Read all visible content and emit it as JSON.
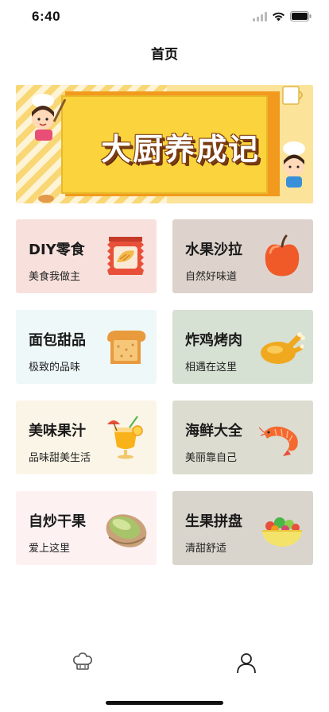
{
  "status_bar": {
    "time": "6:40"
  },
  "nav": {
    "title": "首页"
  },
  "banner": {
    "title": "大厨养成记"
  },
  "categories": [
    {
      "title": "DIY零食",
      "subtitle": "美食我做主",
      "icon": "snack-bag-icon",
      "bg": "#f8e1dc"
    },
    {
      "title": "水果沙拉",
      "subtitle": "自然好味道",
      "icon": "apple-icon",
      "bg": "#ddd3cc"
    },
    {
      "title": "面包甜品",
      "subtitle": "极致的品味",
      "icon": "bread-icon",
      "bg": "#eef8f8"
    },
    {
      "title": "炸鸡烤肉",
      "subtitle": "相遇在这里",
      "icon": "roast-chicken-icon",
      "bg": "#d6e0d3"
    },
    {
      "title": "美味果汁",
      "subtitle": "品味甜美生活",
      "icon": "juice-glass-icon",
      "bg": "#faf5e6"
    },
    {
      "title": "海鲜大全",
      "subtitle": "美丽靠自己",
      "icon": "shrimp-icon",
      "bg": "#dcdcd0"
    },
    {
      "title": "自炒干果",
      "subtitle": "爱上这里",
      "icon": "pistachio-icon",
      "bg": "#fdf1f2"
    },
    {
      "title": "生果拼盘",
      "subtitle": "清甜舒适",
      "icon": "salad-bowl-icon",
      "bg": "#d9d5cd"
    }
  ],
  "tab_bar": {
    "tabs": [
      {
        "icon": "chef-hat-icon"
      },
      {
        "icon": "user-icon"
      }
    ]
  },
  "colors": {
    "banner_yellow": "#f9d33a",
    "banner_orange": "#f29a1e",
    "banner_text_shadow": "#7a3b12"
  }
}
